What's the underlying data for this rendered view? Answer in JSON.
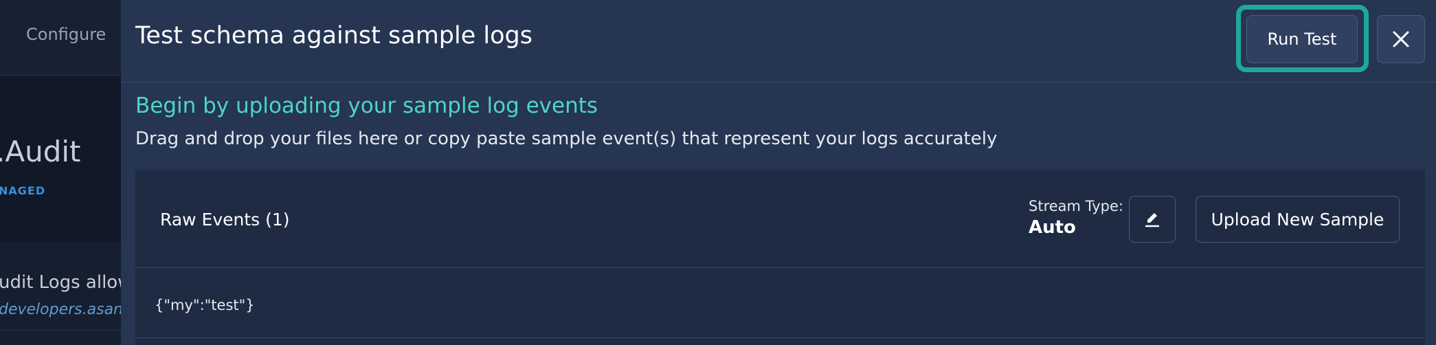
{
  "background_page": {
    "nav_configure": "Configure",
    "source_title": ".Audit",
    "source_badge": "NAGED",
    "description": "udit Logs allows",
    "link_text": "developers.asana"
  },
  "drawer": {
    "title": "Test schema against sample logs",
    "run_test_label": "Run Test",
    "close_icon": "close-icon",
    "intro_heading": "Begin by uploading your sample log events",
    "intro_subtext": "Drag and drop your files here or copy paste sample event(s) that represent your logs accurately",
    "raw_events": {
      "label": "Raw Events (1)",
      "stream_type_label": "Stream Type:",
      "stream_type_value": "Auto",
      "edit_icon": "pencil-icon",
      "upload_label": "Upload New Sample",
      "events": [
        "{\"my\":\"test\"}"
      ]
    }
  },
  "colors": {
    "drawer_bg": "#253552",
    "panel_bg": "#1e2b43",
    "accent_teal": "#4fd6c2",
    "highlight_ring": "#1ea89a",
    "link_blue": "#5e9bd3"
  }
}
